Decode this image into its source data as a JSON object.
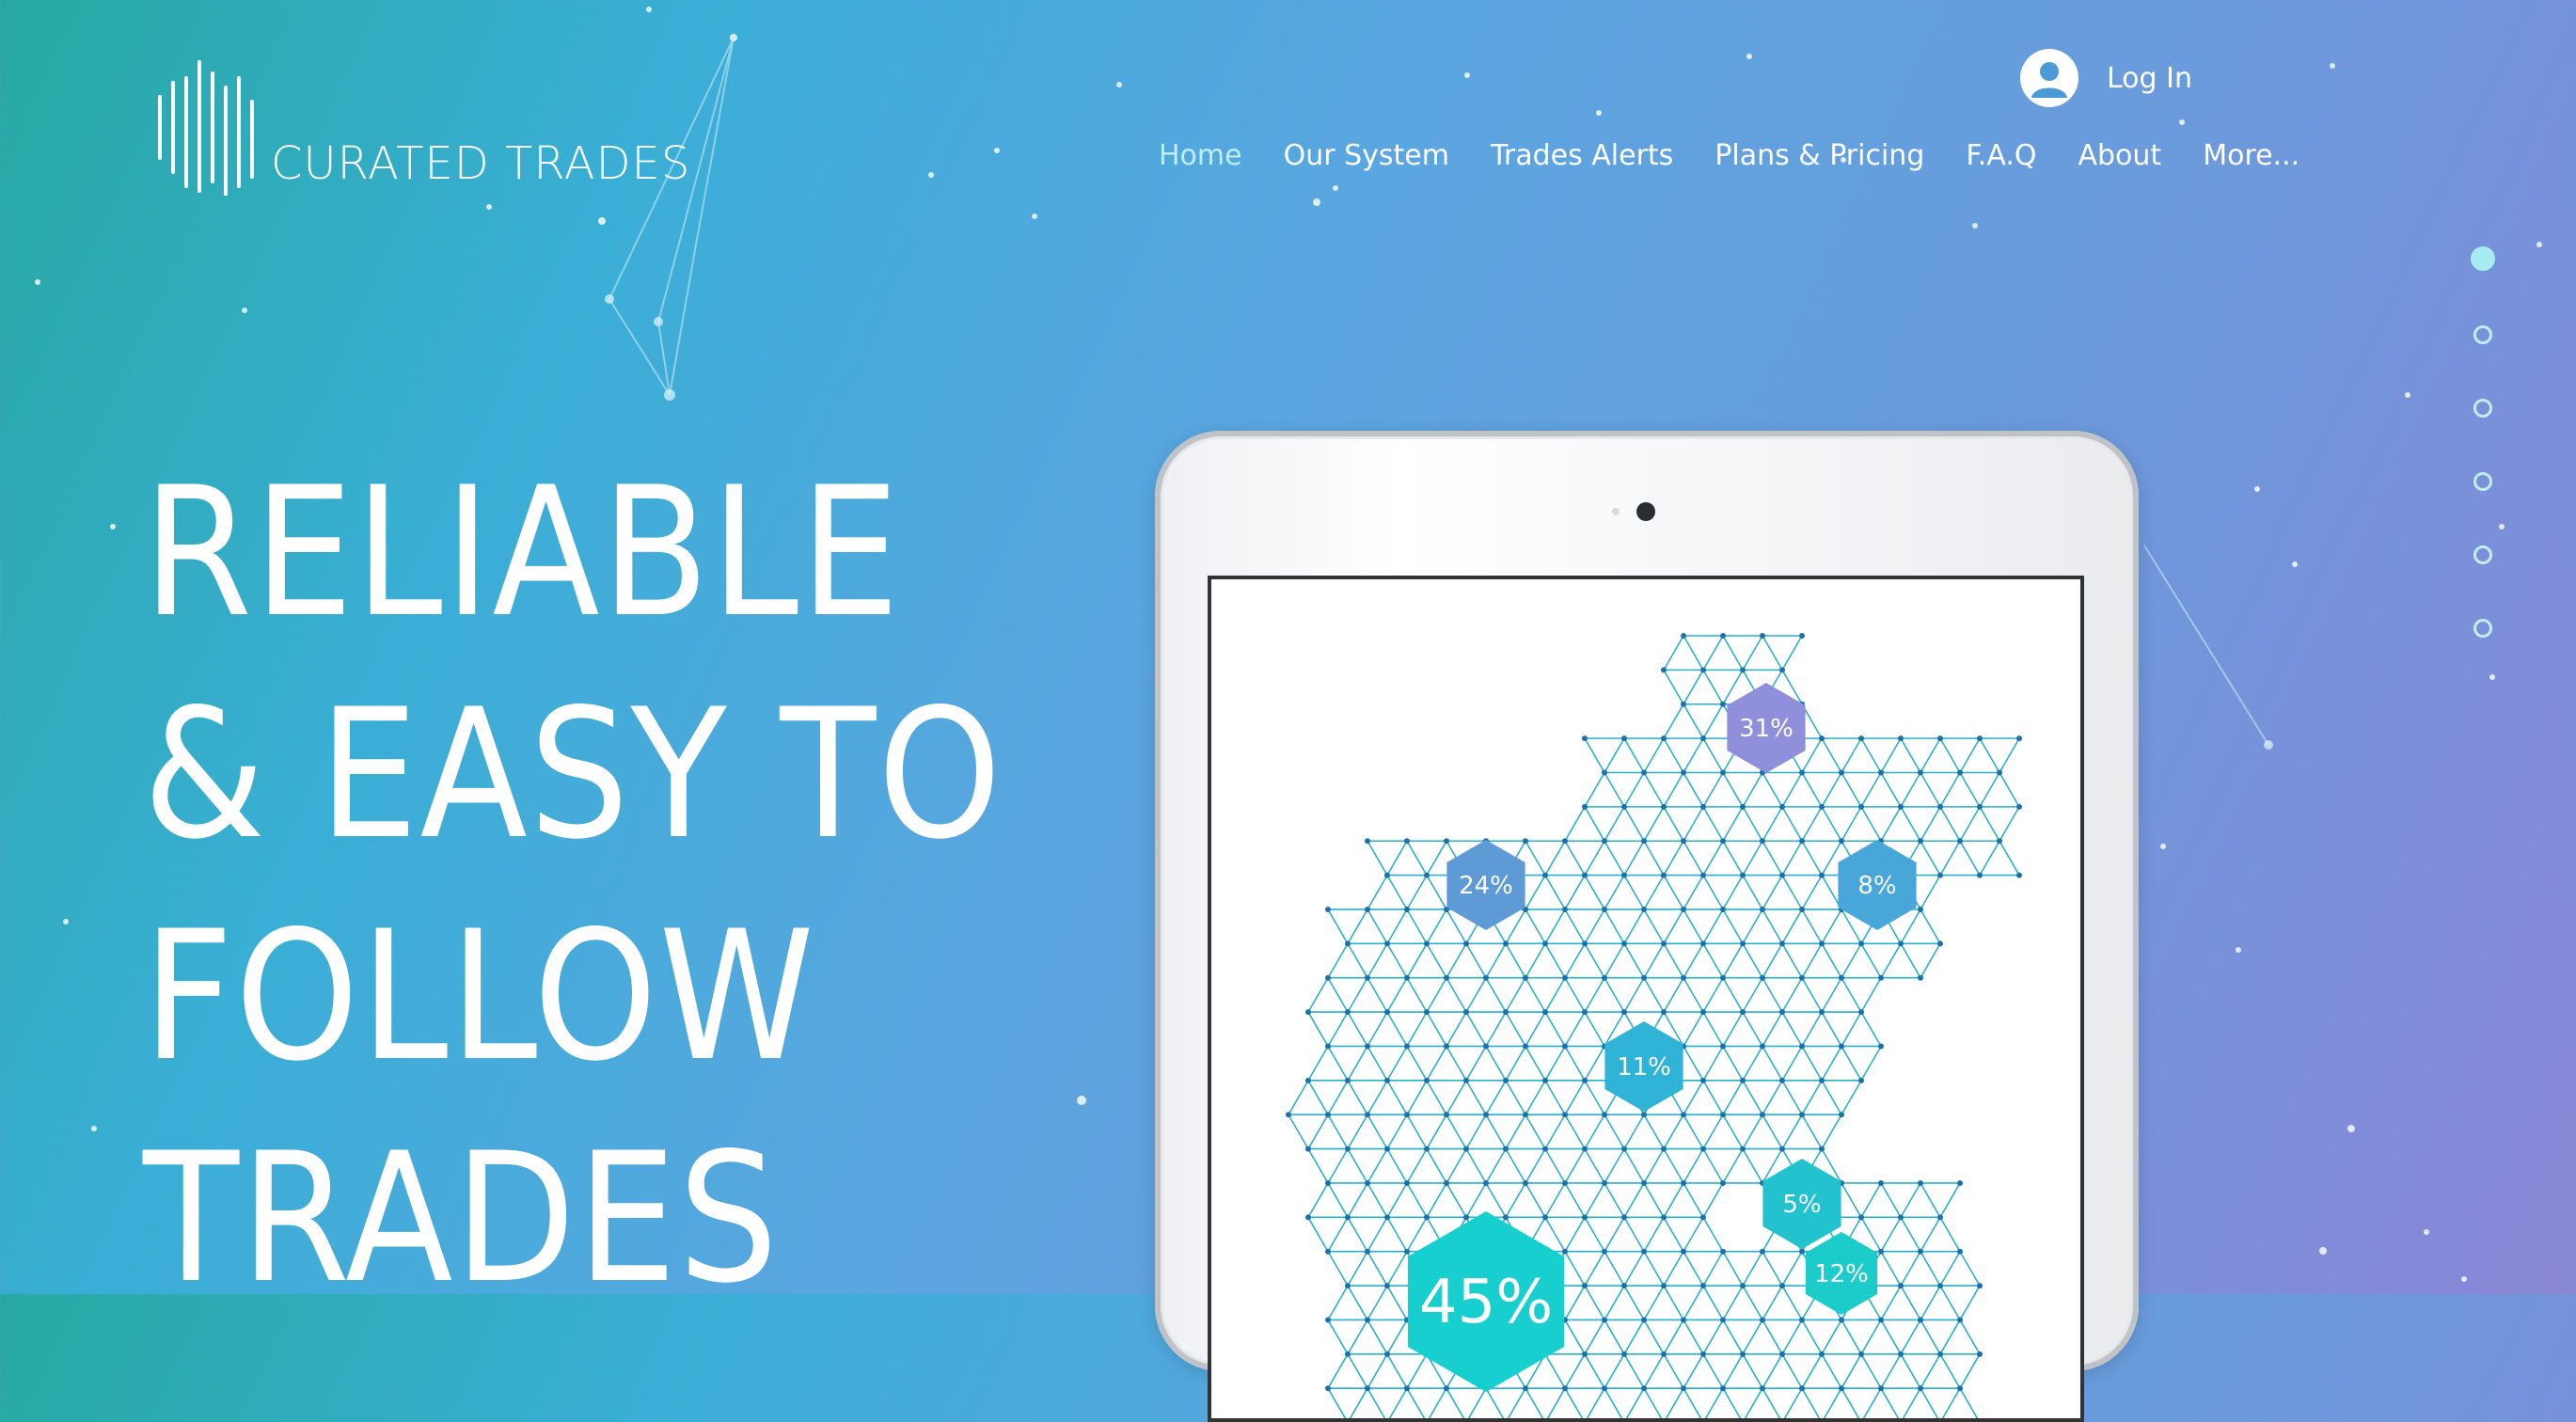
{
  "brand": {
    "name": "CURATED TRADES"
  },
  "header": {
    "login_label": "Log In",
    "nav": [
      {
        "label": "Home",
        "active": true
      },
      {
        "label": "Our System",
        "active": false
      },
      {
        "label": "Trades Alerts",
        "active": false
      },
      {
        "label": "Plans & Pricing",
        "active": false
      },
      {
        "label": "F.A.Q",
        "active": false
      },
      {
        "label": "About",
        "active": false
      },
      {
        "label": "More...",
        "active": false
      }
    ]
  },
  "hero": {
    "lines": [
      "RELIABLE",
      "& EASY TO",
      "FOLLOW",
      "TRADES"
    ]
  },
  "section_dots": {
    "count": 6,
    "active_index": 0
  },
  "tablet_graphic": {
    "hexagons": [
      {
        "label": "31%",
        "color": "#8f8fdc"
      },
      {
        "label": "24%",
        "color": "#5d9ad6"
      },
      {
        "label": "8%",
        "color": "#49a6d8"
      },
      {
        "label": "11%",
        "color": "#2fb3d6"
      },
      {
        "label": "5%",
        "color": "#22c3cf"
      },
      {
        "label": "12%",
        "color": "#1ccccb"
      },
      {
        "label": "45%",
        "color": "#17cfcf"
      }
    ]
  },
  "colors": {
    "background_start": "#27a9a2",
    "background_end": "#8a86d6",
    "active_nav": "#bfeef5",
    "grid_line": "#2ab0c8",
    "grid_node": "#1f6fa8"
  }
}
